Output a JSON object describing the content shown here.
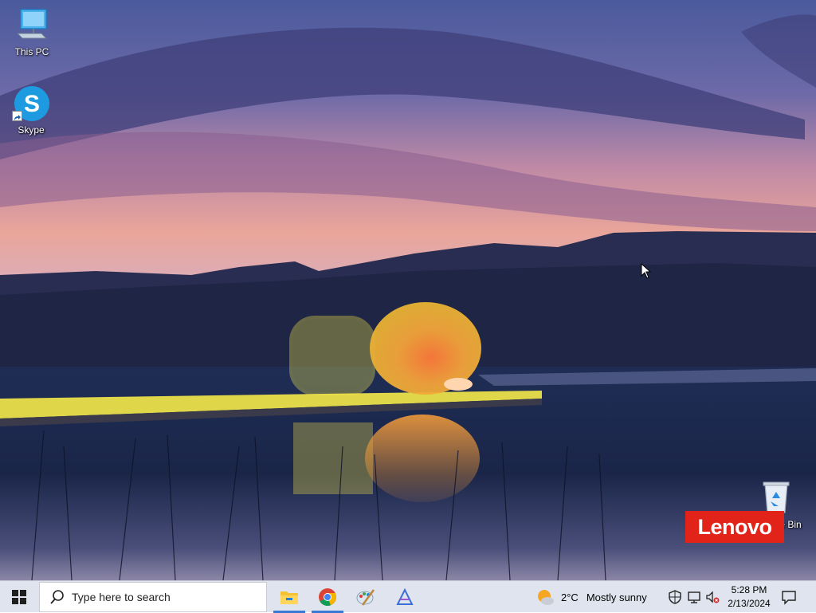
{
  "desktop": {
    "icons": [
      {
        "label": "This PC",
        "icon": "computer-icon"
      },
      {
        "label": "Skype",
        "icon": "skype-icon",
        "glyph": "S"
      },
      {
        "label": "Recycle Bin",
        "icon": "recycle-bin-icon"
      }
    ],
    "brand_badge": "Lenovo"
  },
  "taskbar": {
    "search_placeholder": "Type here to search",
    "pinned_apps": [
      {
        "name": "File Explorer",
        "icon": "folder-icon",
        "active": true
      },
      {
        "name": "Google Chrome",
        "icon": "chrome-icon",
        "active": true
      },
      {
        "name": "Paint",
        "icon": "paint-icon",
        "active": false
      },
      {
        "name": "App",
        "icon": "triangle-app-icon",
        "active": false
      }
    ],
    "weather": {
      "temperature": "2°C",
      "condition": "Mostly sunny"
    },
    "clock": {
      "time": "5:28 PM",
      "date": "2/13/2024"
    }
  },
  "colors": {
    "taskbar_bg": "#dfe4ee",
    "accent": "#3a78d6",
    "lenovo_red": "#e2231a",
    "skype_blue": "#1e9be0"
  }
}
